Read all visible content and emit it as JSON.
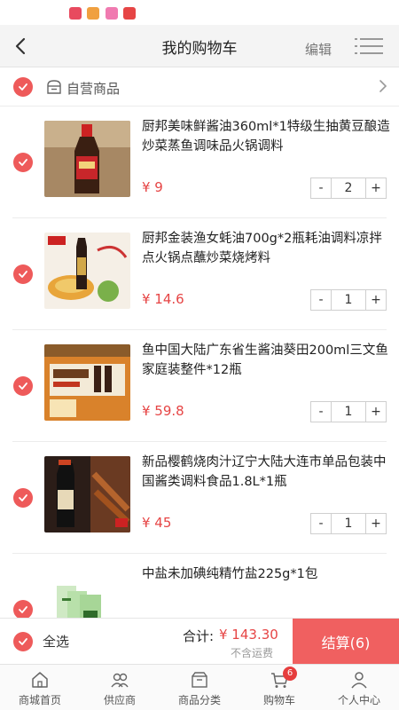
{
  "navbar": {
    "title": "我的购物车",
    "edit_label": "编辑"
  },
  "store": {
    "label": "自营商品"
  },
  "items": [
    {
      "name": "厨邦美味鲜酱油360ml*1特级生抽黄豆酿造炒菜蒸鱼调味品火锅调料",
      "price": "¥ 9",
      "qty": "2"
    },
    {
      "name": "厨邦金装渔女蚝油700g*2瓶耗油调料凉拌点火锅点蘸炒菜烧烤料",
      "price": "¥ 14.6",
      "qty": "1"
    },
    {
      "name": "鱼中国大陆广东省生酱油葵田200ml三文鱼家庭装整件*12瓶",
      "price": "¥ 59.8",
      "qty": "1"
    },
    {
      "name": "新品樱鹤烧肉汁辽宁大陆大连市单品包装中国酱类调料食品1.8L*1瓶",
      "price": "¥ 45",
      "qty": "1"
    },
    {
      "name": "中盐未加碘纯精竹盐225g*1包",
      "price": "",
      "qty": ""
    }
  ],
  "stepper": {
    "minus": "-",
    "plus": "+"
  },
  "checkout": {
    "select_all": "全选",
    "total_label": "合计:",
    "total_value": "¥ 143.30",
    "shipping_note": "不含运费",
    "button": "结算(6)"
  },
  "tabs": [
    {
      "label": "商城首页",
      "icon": "home-icon"
    },
    {
      "label": "供应商",
      "icon": "supplier-icon"
    },
    {
      "label": "商品分类",
      "icon": "category-icon"
    },
    {
      "label": "购物车",
      "icon": "cart-icon",
      "badge": "6"
    },
    {
      "label": "个人中心",
      "icon": "user-icon"
    }
  ],
  "colors": {
    "accent": "#ee5a5a",
    "price": "#e64545",
    "checkout_button": "#f06060"
  }
}
